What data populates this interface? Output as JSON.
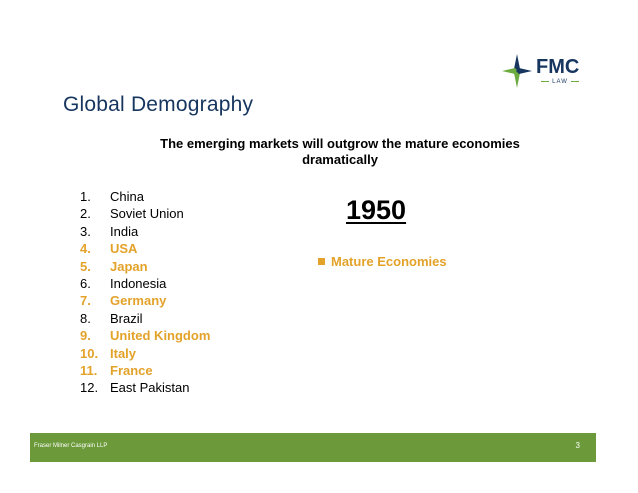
{
  "logo": {
    "name": "FMC",
    "sub": "LAW"
  },
  "title": "Global Demography",
  "subtitle": "The emerging markets will outgrow the mature economies dramatically",
  "year": "1950",
  "legend": {
    "label": "Mature Economies",
    "color": "#e3a22a"
  },
  "countries": [
    {
      "num": "1.",
      "name": "China",
      "mature": false
    },
    {
      "num": "2.",
      "name": "Soviet Union",
      "mature": false
    },
    {
      "num": "3.",
      "name": "India",
      "mature": false
    },
    {
      "num": "4.",
      "name": "USA",
      "mature": true
    },
    {
      "num": "5.",
      "name": "Japan",
      "mature": true
    },
    {
      "num": "6.",
      "name": "Indonesia",
      "mature": false
    },
    {
      "num": "7.",
      "name": "Germany",
      "mature": true
    },
    {
      "num": "8.",
      "name": "Brazil",
      "mature": false
    },
    {
      "num": "9.",
      "name": "United Kingdom",
      "mature": true
    },
    {
      "num": "10.",
      "name": "Italy",
      "mature": true
    },
    {
      "num": "11.",
      "name": "France",
      "mature": true
    },
    {
      "num": "12.",
      "name": "East Pakistan",
      "mature": false
    }
  ],
  "footer": {
    "company": "Fraser Milner Casgrain LLP",
    "page": "3",
    "color": "#6c9a3a"
  },
  "colors": {
    "title": "#16355f",
    "highlight": "#e3a22a",
    "logo_accent": "#6bab3f"
  }
}
